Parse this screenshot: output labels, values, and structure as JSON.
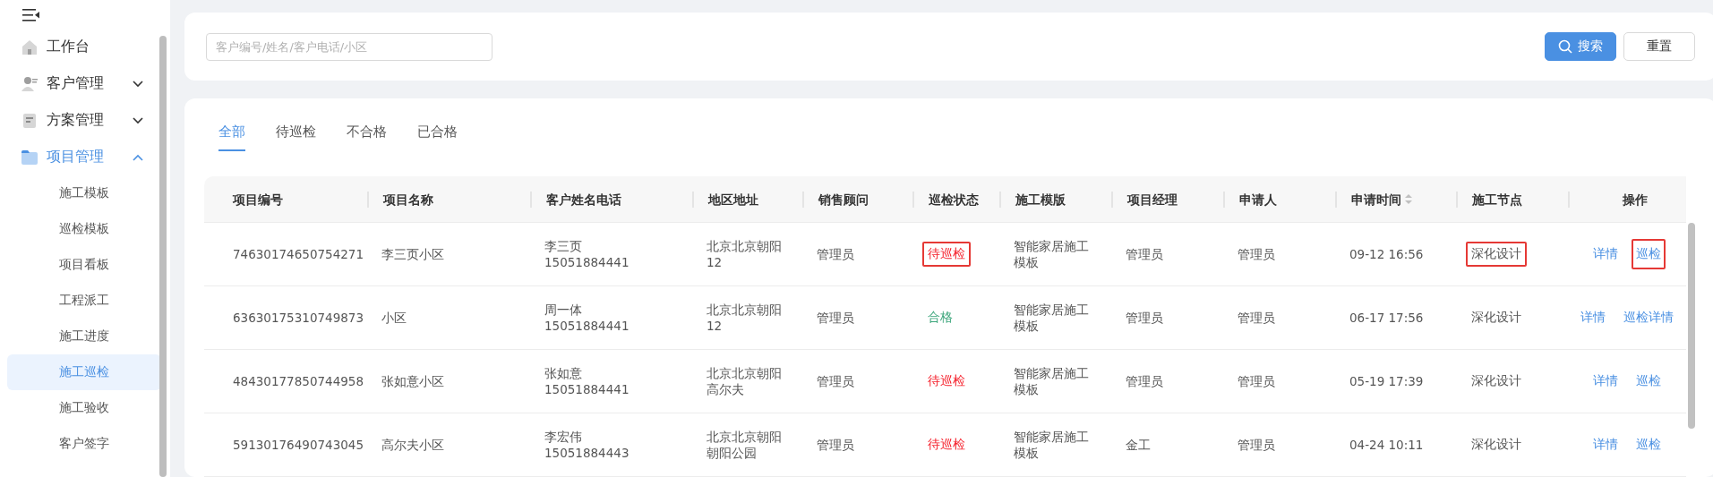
{
  "sidebar": {
    "items": [
      {
        "label": "工作台",
        "expandable": false,
        "expanded": false
      },
      {
        "label": "客户管理",
        "expandable": true,
        "expanded": false
      },
      {
        "label": "方案管理",
        "expandable": true,
        "expanded": false
      },
      {
        "label": "项目管理",
        "expandable": true,
        "expanded": true,
        "children": [
          {
            "label": "施工模板",
            "selected": false
          },
          {
            "label": "巡检模板",
            "selected": false
          },
          {
            "label": "项目看板",
            "selected": false
          },
          {
            "label": "工程派工",
            "selected": false
          },
          {
            "label": "施工进度",
            "selected": false
          },
          {
            "label": "施工巡检",
            "selected": true
          },
          {
            "label": "施工验收",
            "selected": false
          },
          {
            "label": "客户签字",
            "selected": false
          }
        ]
      }
    ]
  },
  "search": {
    "placeholder": "客户编号/姓名/客户电话/小区",
    "buttons": [
      {
        "label": "搜索",
        "kind": "primary"
      },
      {
        "label": "重置",
        "kind": "default"
      }
    ]
  },
  "tabs": [
    {
      "label": "全部",
      "selected": true
    },
    {
      "label": "待巡检",
      "selected": false
    },
    {
      "label": "不合格",
      "selected": false
    },
    {
      "label": "已合格",
      "selected": false
    }
  ],
  "table": {
    "columns": [
      {
        "label": "项目编号",
        "sortable": false
      },
      {
        "label": "项目名称",
        "sortable": false
      },
      {
        "label": "客户姓名电话",
        "sortable": false
      },
      {
        "label": "地区地址",
        "sortable": false
      },
      {
        "label": "销售顾问",
        "sortable": false
      },
      {
        "label": "巡检状态",
        "sortable": false
      },
      {
        "label": "施工模版",
        "sortable": false
      },
      {
        "label": "项目经理",
        "sortable": false
      },
      {
        "label": "申请人",
        "sortable": false
      },
      {
        "label": "申请时间",
        "sortable": true
      },
      {
        "label": "施工节点",
        "sortable": false
      },
      {
        "label": "操作",
        "sortable": false
      }
    ],
    "rows": [
      {
        "cells": [
          {
            "kind": "text",
            "lines": [
              "74630174650754271"
            ]
          },
          {
            "kind": "text",
            "lines": [
              "李三页小区"
            ]
          },
          {
            "kind": "text",
            "lines": [
              "李三页",
              "15051884441"
            ]
          },
          {
            "kind": "text",
            "lines": [
              "北京北京朝阳",
              "12"
            ]
          },
          {
            "kind": "text",
            "lines": [
              "管理员"
            ]
          },
          {
            "kind": "status",
            "text": "待巡检",
            "color": "#f5222d",
            "highlighted": true
          },
          {
            "kind": "text",
            "lines": [
              "智能家居施工",
              "模板"
            ]
          },
          {
            "kind": "text",
            "lines": [
              "管理员"
            ]
          },
          {
            "kind": "text",
            "lines": [
              "管理员"
            ]
          },
          {
            "kind": "text",
            "lines": [
              "09-12 16:56"
            ]
          },
          {
            "kind": "status",
            "text": "深化设计",
            "color": "#555555",
            "highlighted": true
          },
          {
            "kind": "actions",
            "links": [
              {
                "label": "详情",
                "highlighted": false
              },
              {
                "label": "巡检",
                "highlighted": true
              }
            ]
          }
        ]
      },
      {
        "cells": [
          {
            "kind": "text",
            "lines": [
              "63630175310749873"
            ]
          },
          {
            "kind": "text",
            "lines": [
              "小区"
            ]
          },
          {
            "kind": "text",
            "lines": [
              "周一体",
              "15051884441"
            ]
          },
          {
            "kind": "text",
            "lines": [
              "北京北京朝阳",
              "12"
            ]
          },
          {
            "kind": "text",
            "lines": [
              "管理员"
            ]
          },
          {
            "kind": "status",
            "text": "合格",
            "color": "#3aa57a",
            "highlighted": false
          },
          {
            "kind": "text",
            "lines": [
              "智能家居施工",
              "模板"
            ]
          },
          {
            "kind": "text",
            "lines": [
              "管理员"
            ]
          },
          {
            "kind": "text",
            "lines": [
              "管理员"
            ]
          },
          {
            "kind": "text",
            "lines": [
              "06-17 17:56"
            ]
          },
          {
            "kind": "status",
            "text": "深化设计",
            "color": "#555555",
            "highlighted": false
          },
          {
            "kind": "actions",
            "links": [
              {
                "label": "详情",
                "highlighted": false
              },
              {
                "label": "巡检详情",
                "highlighted": false
              }
            ]
          }
        ]
      },
      {
        "cells": [
          {
            "kind": "text",
            "lines": [
              "48430177850744958"
            ]
          },
          {
            "kind": "text",
            "lines": [
              "张如意小区"
            ]
          },
          {
            "kind": "text",
            "lines": [
              "张如意",
              "15051884441"
            ]
          },
          {
            "kind": "text",
            "lines": [
              "北京北京朝阳",
              "高尔夫"
            ]
          },
          {
            "kind": "text",
            "lines": [
              "管理员"
            ]
          },
          {
            "kind": "status",
            "text": "待巡检",
            "color": "#f5222d",
            "highlighted": false
          },
          {
            "kind": "text",
            "lines": [
              "智能家居施工",
              "模板"
            ]
          },
          {
            "kind": "text",
            "lines": [
              "管理员"
            ]
          },
          {
            "kind": "text",
            "lines": [
              "管理员"
            ]
          },
          {
            "kind": "text",
            "lines": [
              "05-19 17:39"
            ]
          },
          {
            "kind": "status",
            "text": "深化设计",
            "color": "#555555",
            "highlighted": false
          },
          {
            "kind": "actions",
            "links": [
              {
                "label": "详情",
                "highlighted": false
              },
              {
                "label": "巡检",
                "highlighted": false
              }
            ]
          }
        ]
      },
      {
        "cells": [
          {
            "kind": "text",
            "lines": [
              "59130176490743045"
            ]
          },
          {
            "kind": "text",
            "lines": [
              "高尔夫小区"
            ]
          },
          {
            "kind": "text",
            "lines": [
              "李宏伟",
              "15051884443"
            ]
          },
          {
            "kind": "text",
            "lines": [
              "北京北京朝阳",
              "朝阳公园"
            ]
          },
          {
            "kind": "text",
            "lines": [
              "管理员"
            ]
          },
          {
            "kind": "status",
            "text": "待巡检",
            "color": "#f5222d",
            "highlighted": false
          },
          {
            "kind": "text",
            "lines": [
              "智能家居施工",
              "模板"
            ]
          },
          {
            "kind": "text",
            "lines": [
              "金工"
            ]
          },
          {
            "kind": "text",
            "lines": [
              "管理员"
            ]
          },
          {
            "kind": "text",
            "lines": [
              "04-24 10:11"
            ]
          },
          {
            "kind": "status",
            "text": "深化设计",
            "color": "#555555",
            "highlighted": false
          },
          {
            "kind": "actions",
            "links": [
              {
                "label": "详情",
                "highlighted": false
              },
              {
                "label": "巡检",
                "highlighted": false
              }
            ]
          }
        ]
      }
    ]
  }
}
